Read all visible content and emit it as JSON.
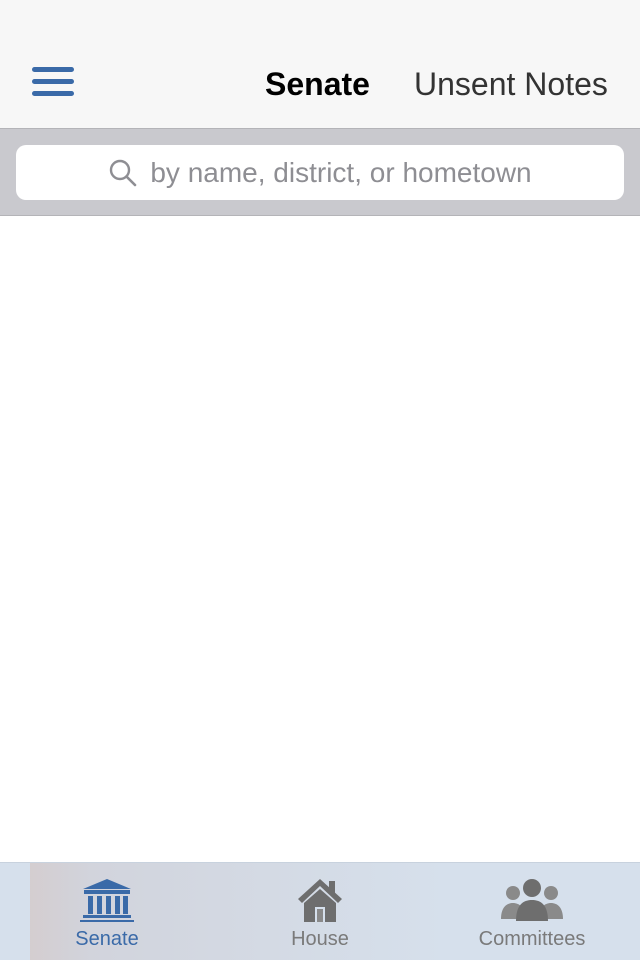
{
  "nav": {
    "menu_icon": "hamburger-menu-icon",
    "tabs": [
      {
        "label": "Senate",
        "active": true
      },
      {
        "label": "Unsent Notes",
        "active": false
      }
    ]
  },
  "search": {
    "placeholder": "by name, district, or hometown",
    "icon": "search-icon"
  },
  "tab_bar": {
    "items": [
      {
        "label": "Senate",
        "icon": "capitol-building-icon",
        "selected": true
      },
      {
        "label": "House",
        "icon": "house-icon",
        "selected": false
      },
      {
        "label": "Committees",
        "icon": "people-group-icon",
        "selected": false
      }
    ]
  },
  "colors": {
    "accent": "#3a6aa8",
    "nav_background": "#f7f7f7",
    "search_bar_background": "#c9c9ce",
    "tab_bar_background": "#d6e0ec",
    "inactive_icon": "#6e6e6e"
  }
}
